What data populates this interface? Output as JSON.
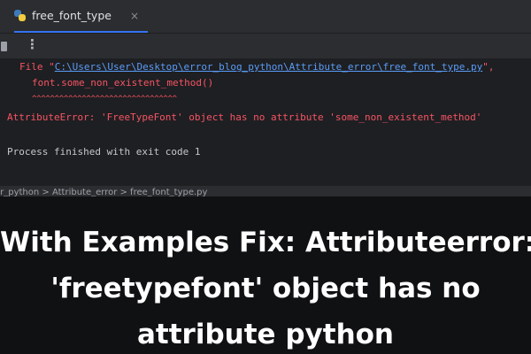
{
  "tab": {
    "label": "free_font_type",
    "close_glyph": "×"
  },
  "toolbar": {
    "more_glyph": "⋮"
  },
  "console": {
    "file_prefix": "File \"",
    "file_path": "C:\\Users\\User\\Desktop\\error_blog_python\\Attribute_error\\free_font_type.py",
    "file_suffix": "\",",
    "code_line": "font.some_non_existent_method()",
    "caret_line": "^^^^^^^^^^^^^^^^^^^^^^^^^^^^^^^^",
    "error_line": "AttributeError: 'FreeTypeFont' object has no attribute 'some_non_existent_method'",
    "exit_line": "Process finished with exit code 1"
  },
  "breadcrumb": {
    "text": "or_python  >  Attribute_error  >  free_font_type.py"
  },
  "caption": {
    "line1": "With Examples Fix: Attributeerror:",
    "line2": "'freetypefont' object has no",
    "line3": "attribute python"
  },
  "icons": {
    "tab_icon": "python-file-icon",
    "stop": "stop-icon",
    "more": "more-vertical-icon"
  },
  "colors": {
    "error_red": "#f75464",
    "link_blue": "#5a9cf8",
    "console_bg": "#1e1f22",
    "caption_bg": "#101113"
  }
}
